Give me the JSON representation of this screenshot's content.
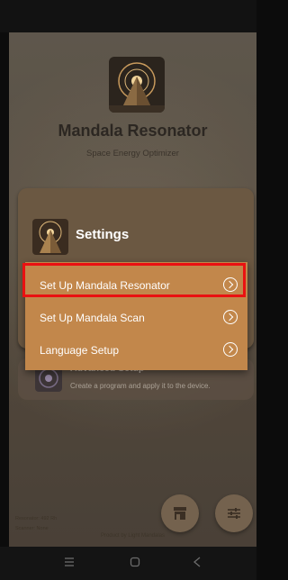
{
  "app": {
    "title": "Mandala Resonator",
    "subtitle": "Space Energy Optimizer"
  },
  "settings_card": {
    "title": "Settings"
  },
  "menu": {
    "items": [
      {
        "label": "Set Up Mandala Resonator",
        "highlighted": true
      },
      {
        "label": "Set Up Mandala Scan",
        "highlighted": false
      },
      {
        "label": "Language Setup",
        "highlighted": false
      }
    ]
  },
  "advanced": {
    "title": "Advanced Setup",
    "description": "Create a program and apply it to the device."
  },
  "status": {
    "resonator": "Resonator: 492 Rh",
    "scanner": "Scanner: None"
  },
  "footer": {
    "credit": "Product by Light Mandalas"
  },
  "icons": {
    "store": "store-icon",
    "sliders": "sliders-icon",
    "nav_menu": "menu-icon",
    "nav_home": "home-icon",
    "nav_back": "back-icon"
  },
  "colors": {
    "menu_bg": "#c2874b",
    "highlight": "#ea1111",
    "card_bg": "#6b5842"
  }
}
